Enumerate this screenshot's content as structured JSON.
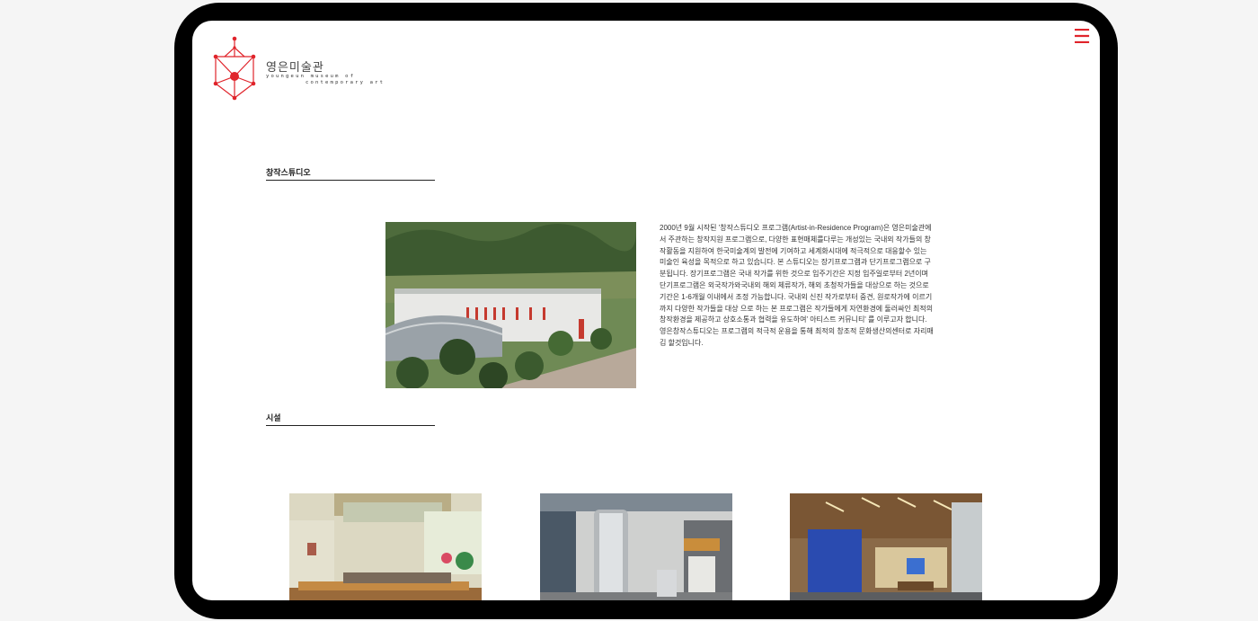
{
  "brand": {
    "name_kr": "영은미술관",
    "name_en_line1": "youngeun museum of",
    "name_en_line2": "contemporary art",
    "accent_color": "#e0242b"
  },
  "nav": {
    "menu_icon": "hamburger-menu-icon",
    "menu_glyph": "☰"
  },
  "studio": {
    "title": "창작스튜디오",
    "description": "2000년 9월 시작된 '창작스튜디오 프로그램(Artist-in-Residence Program)은 영은미술관에서 주관하는 창작지원 프로그램으로, 다양한 표현매체를다루는 개성있는 국내외 작가들의 창작활동을 지원하여 한국미술계의 발전에 기여하고 세계화시대에 적극적으로 대응할수 있는 미술인 육성을 목적으로 하고 있습니다. 본 스튜디오는 장기프로그램과 단기프로그램으로 구분됩니다. 장기프로그램은 국내 작가를 위한 것으로 입주기간은 지정 입주일로부터 2년이며 단기프로그램은 외국작가와국내외 해외 체류작가, 해외 초청작가들을 대상으로 하는 것으로 기간은 1-6개월 이내에서 조정 가능합니다. 국내외 신진 작가로부터 중견, 원로작가에 이르기까지 다양한 작가들을 대상 으로 하는 본 프로그램은 작가들에게 자연환경에 둘러싸인 최적의 창작환경을 제공하고 상호소통과 협력을 유도하여' 아티스트 커뮤니티' 를 이루고자 합니다. 영은창작스튜디오는 프로그램의 적극적 운용을 통해 최적의 창조적 문화생산의센터로 자리매김 할것입니다."
  },
  "facilities": {
    "title": "시설"
  }
}
